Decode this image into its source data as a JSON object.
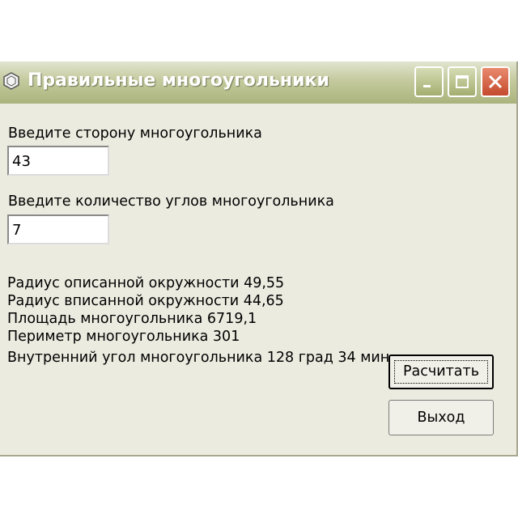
{
  "window": {
    "title": "Правильные многоугольники"
  },
  "form": {
    "side_label": "Введите сторону многоугольника",
    "side_value": "43",
    "angles_label": "Введите количество углов многоугольника",
    "angles_value": "7"
  },
  "results": {
    "circumradius": "Радиус описанной окружности  49,55",
    "inradius": "Радиус вписанной окружности  44,65",
    "area": "Площадь многоугольника  6719,1",
    "perimeter": "Периметр многоугольника  301",
    "interior_angle": "Внутренний угол многоугольника 128 град  34  мин"
  },
  "buttons": {
    "calculate": "Расчитать",
    "exit": "Выход"
  }
}
